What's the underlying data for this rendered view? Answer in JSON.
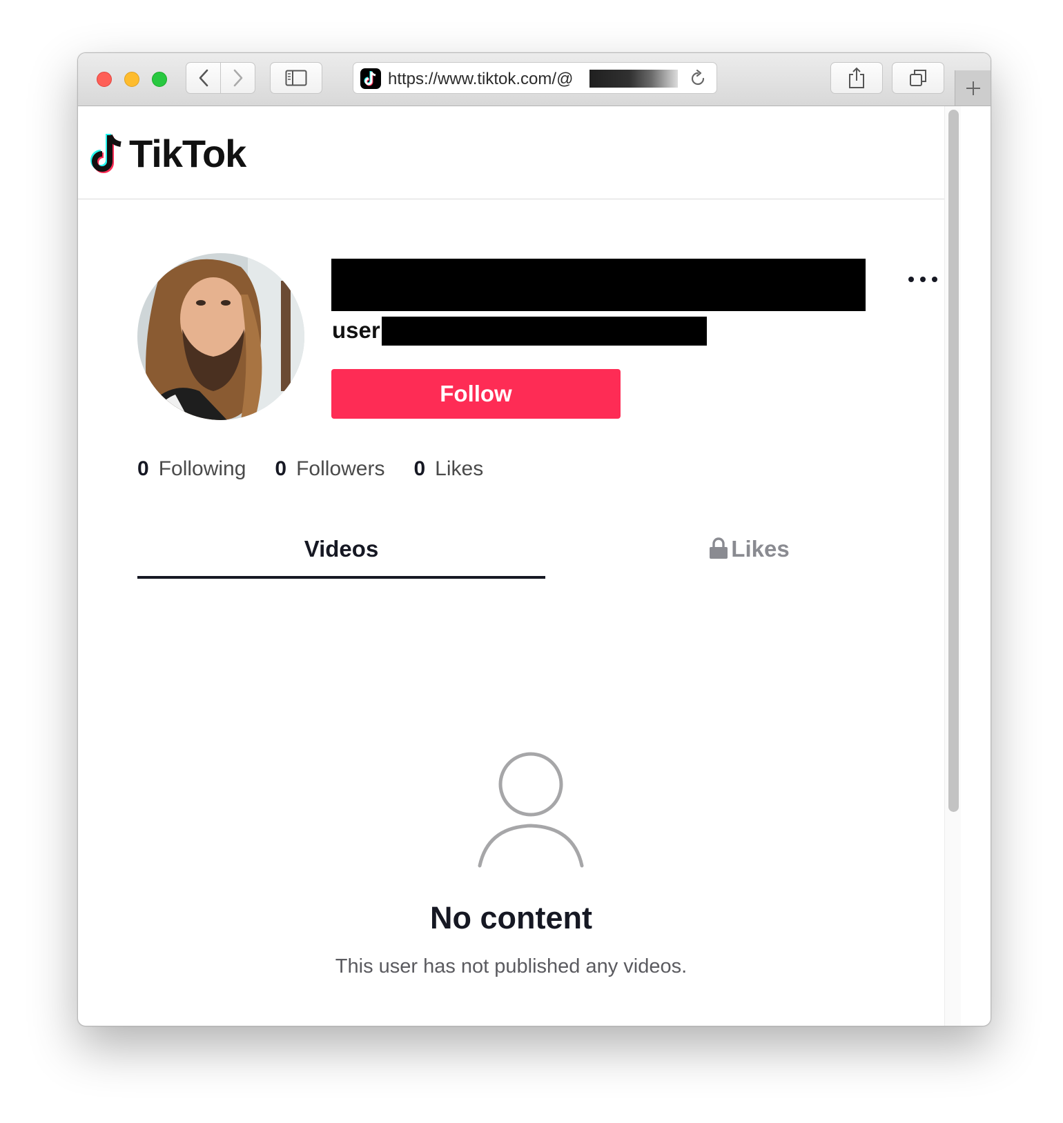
{
  "browser": {
    "url": "https://www.tiktok.com/@",
    "url_redacted": true
  },
  "site": {
    "logo_text": "TikTok"
  },
  "profile": {
    "display_name_redacted": true,
    "handle_prefix": "user",
    "handle_redacted": true,
    "follow_label": "Follow",
    "stats": [
      {
        "count": "0",
        "label": "Following"
      },
      {
        "count": "0",
        "label": "Followers"
      },
      {
        "count": "0",
        "label": "Likes"
      }
    ]
  },
  "tabs": {
    "videos": "Videos",
    "likes": "Likes",
    "active": "videos"
  },
  "empty_state": {
    "title": "No content",
    "description": "This user has not published any videos."
  },
  "colors": {
    "accent": "#fe2c55",
    "text_primary": "#161823",
    "tab_inactive": "#8a8b91"
  },
  "icons": [
    "back-icon",
    "forward-icon",
    "sidebar-icon",
    "tiktok-favicon",
    "reload-icon",
    "share-icon",
    "tabs-icon",
    "plus-icon",
    "more-icon",
    "lock-icon",
    "user-outline-icon"
  ]
}
